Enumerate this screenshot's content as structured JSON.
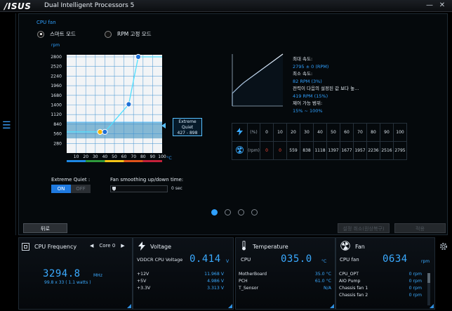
{
  "app": {
    "logo": "/ISUS",
    "title": "Dual Intelligent Processors 5",
    "minimize": "—",
    "close": "✕"
  },
  "fan_tuning": {
    "section": "CPU fan",
    "modes": [
      {
        "label": "스마트 모드",
        "selected": true
      },
      {
        "label": "RPM 고정 모드",
        "selected": false
      }
    ],
    "curve": {
      "rpm_unit": "rpm",
      "y_ticks": [
        "2800",
        "2520",
        "2240",
        "1960",
        "1680",
        "1400",
        "1120",
        "840",
        "560",
        "280"
      ],
      "x_ticks": [
        "10",
        "20",
        "30",
        "40",
        "50",
        "60",
        "70",
        "80",
        "90",
        "100"
      ],
      "x_unit": "°C",
      "points": [
        {
          "temp": 35,
          "rpm": 615
        },
        {
          "temp": 40,
          "rpm": 615
        },
        {
          "temp": 65,
          "rpm": 1420
        },
        {
          "temp": 75,
          "rpm": 2800
        }
      ],
      "quiet_band": [
        427,
        898
      ],
      "zone_colors": [
        "#1e88e5",
        "#2e9a3c",
        "#f5c518",
        "#e0531a",
        "#c4213a"
      ]
    },
    "extreme_quiet": {
      "label": "Extreme Quiet",
      "range": "427 - 898",
      "toggle_label": "Extreme Quiet :",
      "on": "ON",
      "off": "OFF"
    },
    "smoothing": {
      "label": "Fan smoothing up/down time:",
      "value": "0 sec"
    },
    "info": {
      "max_speed_label": "최대 속도:",
      "max_speed_value": "2795 ± 0 (RPM)",
      "min_speed_label": "최소 속도:",
      "min_speed_value": "82 RPM (3%)",
      "power_label": "전력이 다음의 설정된 값 보다 높...",
      "power_value": "419 RPM (15%)",
      "range_label": "제어 가능 범위:",
      "range_value": "15% ~ 100%"
    },
    "duty_table": {
      "percent_unit": "(%)",
      "rpm_unit": "(rpm)",
      "percent": [
        "0",
        "10",
        "20",
        "30",
        "40",
        "50",
        "60",
        "70",
        "80",
        "90",
        "100"
      ],
      "rpm": [
        "0",
        "0",
        "559",
        "838",
        "1118",
        "1397",
        "1677",
        "1957",
        "2236",
        "2516",
        "2795"
      ]
    },
    "pages": 4,
    "active_page": 0,
    "back_button": "뒤로",
    "apply_defaults_button": "설정 취소(원상복구)",
    "apply_button": "적용"
  },
  "cpu_freq": {
    "title": "CPU Frequency",
    "core": "Core 0",
    "value": "3294.8",
    "unit": "MHz",
    "detail": "99.8  x  33    ( 1.1  watts )"
  },
  "voltage": {
    "title": "Voltage",
    "main_label": "VDDCR CPU Voltage",
    "main_value": "0.414",
    "main_unit": "V",
    "rows": [
      {
        "label": "+12V",
        "value": "11.968  V"
      },
      {
        "label": "+5V",
        "value": "4.986  V"
      },
      {
        "label": "+3.3V",
        "value": "3.313  V"
      }
    ]
  },
  "temperature": {
    "title": "Temperature",
    "main_label": "CPU",
    "main_value": "035.0",
    "main_unit": "°C",
    "rows": [
      {
        "label": "MotherBoard",
        "value": "35.0 °C"
      },
      {
        "label": "PCH",
        "value": "61.0 °C"
      },
      {
        "label": "T_Sensor",
        "value": "N/A"
      }
    ]
  },
  "fan": {
    "title": "Fan",
    "main_label": "CPU fan",
    "main_value": "0634",
    "main_unit": "rpm",
    "rows": [
      {
        "label": "CPU_OPT",
        "value": "0  rpm"
      },
      {
        "label": "AIO Pump",
        "value": "0  rpm"
      },
      {
        "label": "Chassis fan 1",
        "value": "0  rpm"
      },
      {
        "label": "Chassis fan 2",
        "value": "0  rpm"
      }
    ]
  }
}
